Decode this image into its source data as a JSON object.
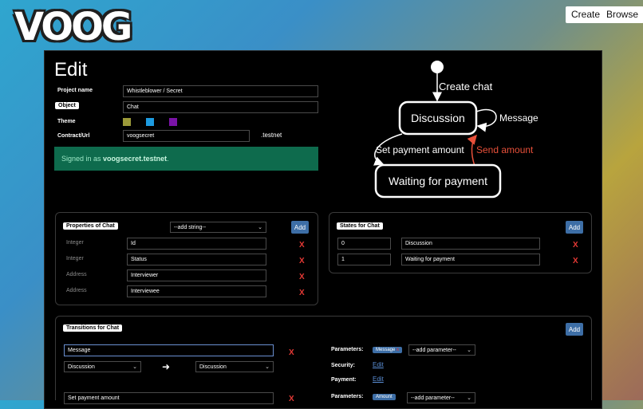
{
  "brand": {
    "logo_text": "VOOG"
  },
  "topbar": {
    "create_label": "Create",
    "browse_label": "Browse"
  },
  "edit": {
    "heading": "Edit",
    "project_name_label": "Project name",
    "project_name_value": "Whistleblower / Secret",
    "object_label": "Object",
    "object_value": "Chat",
    "theme_label": "Theme",
    "theme_colors": [
      "#9c9a3a",
      "#1d9be0",
      "#7a13a6"
    ],
    "contract_label": "Contract/Url",
    "contract_value": "voogsecret",
    "contract_suffix": ".testnet",
    "signed_prefix": "Signed in as ",
    "signed_account": "voogsecret.testnet",
    "signed_suffix": "."
  },
  "diagram": {
    "create_label": "Create chat",
    "state_discussion": "Discussion",
    "state_waiting": "Waiting for payment",
    "loop_label": "Message",
    "set_payment_label": "Set payment amount",
    "send_amount_label": "Send amount",
    "send_amount_color": "#e8503a"
  },
  "properties": {
    "title": "Properties of Chat",
    "add_select": "--add string--",
    "add_label": "Add",
    "rows": [
      {
        "type": "Integer",
        "name": "Id"
      },
      {
        "type": "Integer",
        "name": "Status"
      },
      {
        "type": "Address",
        "name": "Interviewer"
      },
      {
        "type": "Address",
        "name": "Interviewee"
      }
    ],
    "delete_glyph": "X"
  },
  "states": {
    "title": "States for Chat",
    "add_label": "Add",
    "rows": [
      {
        "id": "0",
        "name": "Discussion"
      },
      {
        "id": "1",
        "name": "Waiting for payment"
      }
    ]
  },
  "transitions": {
    "title": "Transitions for Chat",
    "add_label": "Add",
    "t1": {
      "name": "Message",
      "from": "Discussion",
      "to": "Discussion",
      "params_label": "Parameters:",
      "param_tag": "Message",
      "add_param": "--add parameter--",
      "security_label": "Security:",
      "security_link": "Edit",
      "payment_label": "Payment:",
      "payment_link": "Edit"
    },
    "t2": {
      "name": "Set payment amount",
      "params_label": "Parameters:",
      "param_tag": "Amount",
      "add_param": "--add parameter--"
    }
  }
}
